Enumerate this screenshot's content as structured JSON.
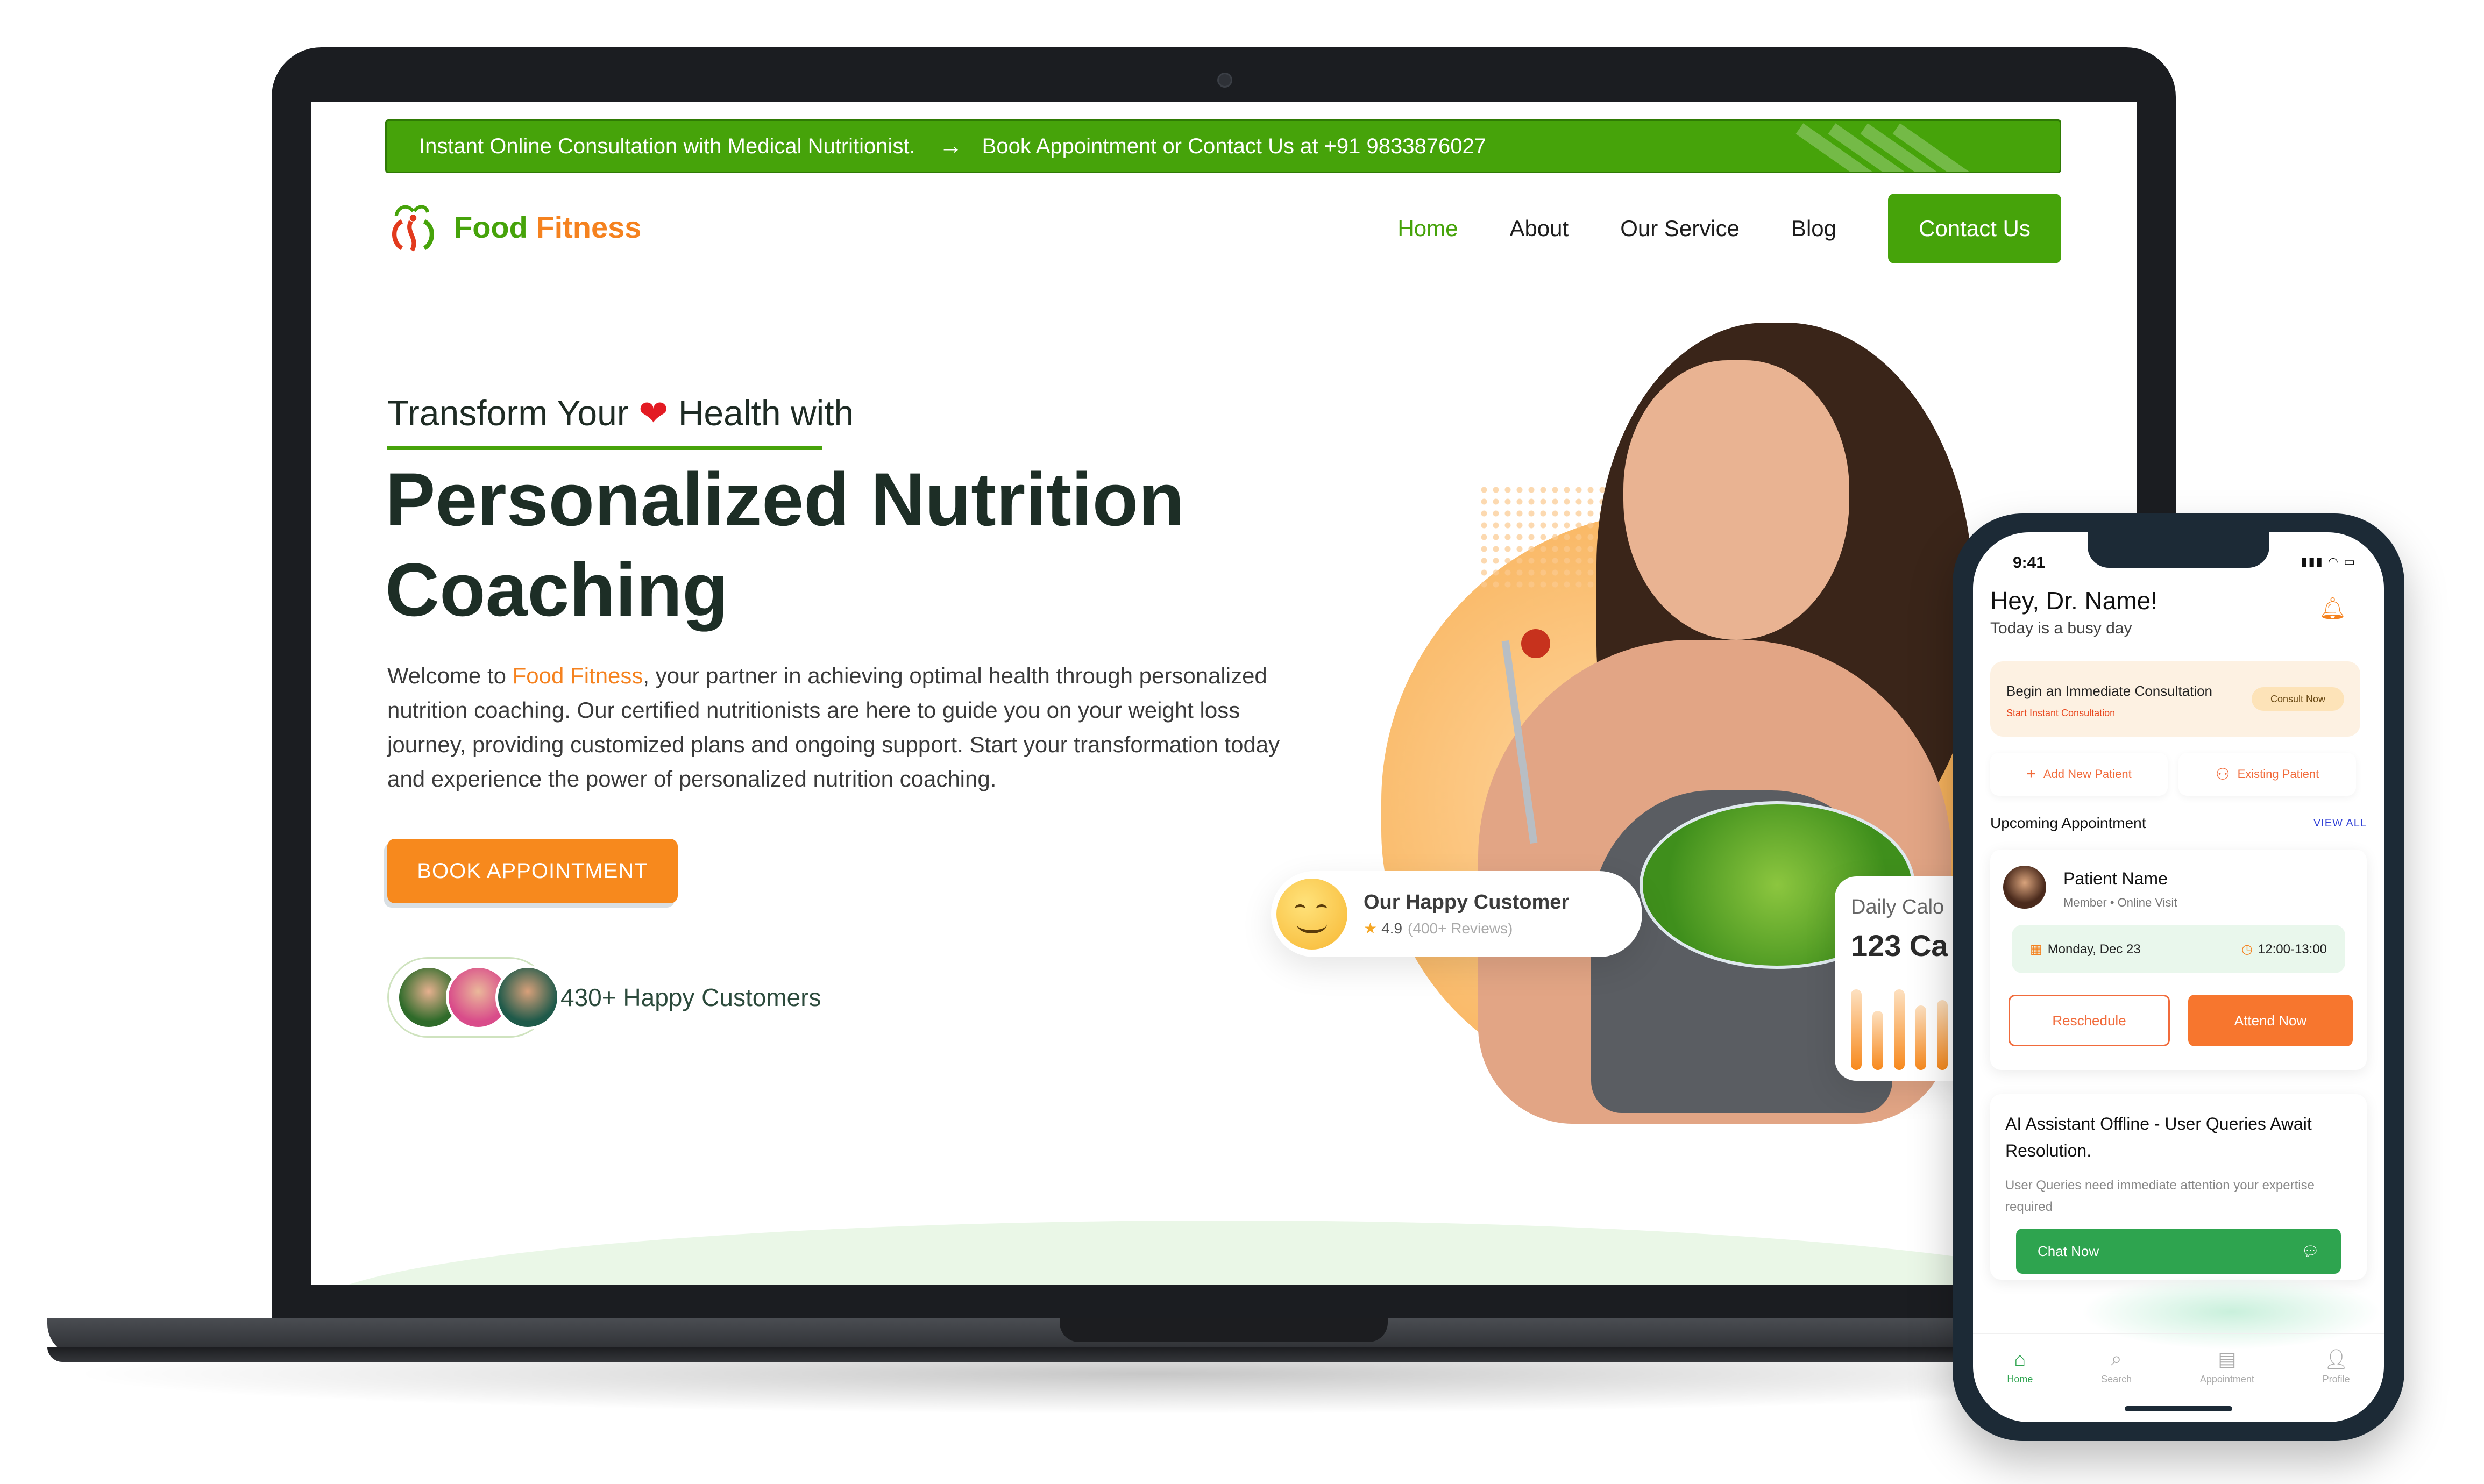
{
  "website": {
    "topbar": {
      "left_text": "Instant Online Consultation with Medical Nutritionist.",
      "right_text": "Book Appointment or Contact Us at +91 9833876027"
    },
    "logo": {
      "word1": "Food",
      "word2": "Fitness"
    },
    "nav": {
      "home": "Home",
      "about": "About",
      "service": "Our Service",
      "blog": "Blog",
      "contact": "Contact Us"
    },
    "hero": {
      "tagline_before": "Transform Your",
      "tagline_after": "Health with",
      "headline_line1": "Personalized Nutrition",
      "headline_line2": "Coaching",
      "intro_before": "Welcome to ",
      "intro_brand": "Food Fitness",
      "intro_after": ", your partner in achieving optimal health through personalized nutrition coaching. Our certified nutritionists are here to guide you on your weight loss journey, providing customized plans and ongoing support. Start your transformation today and experience the power of personalized nutrition coaching.",
      "book_button": "BOOK APPOINTMENT",
      "customers_text": "430+ Happy Customers"
    },
    "review_card": {
      "title": "Our Happy Customer",
      "rating": "4.9",
      "reviews": "(400+ Reviews)"
    },
    "calorie_card": {
      "label": "Daily Calo",
      "value": "123 Ca"
    }
  },
  "phone": {
    "time": "9:41",
    "greeting": "Hey, Dr. Name!",
    "subtitle": "Today is a busy day",
    "consult": {
      "title": "Begin an Immediate Consultation",
      "sub": "Start Instant Consultation",
      "button": "Consult Now"
    },
    "actions": {
      "add": "Add New Patient",
      "existing": "Existing Patient"
    },
    "upcoming": {
      "title": "Upcoming Appointment",
      "view_all": "VIEW ALL"
    },
    "appointment": {
      "name": "Patient Name",
      "member": "Member",
      "visit": "Online Visit",
      "date": "Monday, Dec 23",
      "time": "12:00-13:00",
      "reschedule": "Reschedule",
      "attend": "Attend Now"
    },
    "ai": {
      "title": "AI Assistant Offline - User Queries Await Resolution.",
      "desc": "User Queries need immediate attention your expertise required",
      "chat": "Chat Now"
    },
    "tabs": {
      "home": "Home",
      "search": "Search",
      "appointment": "Appointment",
      "profile": "Profile"
    }
  },
  "colors": {
    "brand_green": "#46a30a",
    "brand_orange": "#f5821f",
    "app_green": "#2ea44f",
    "app_orange": "#f7762e"
  }
}
